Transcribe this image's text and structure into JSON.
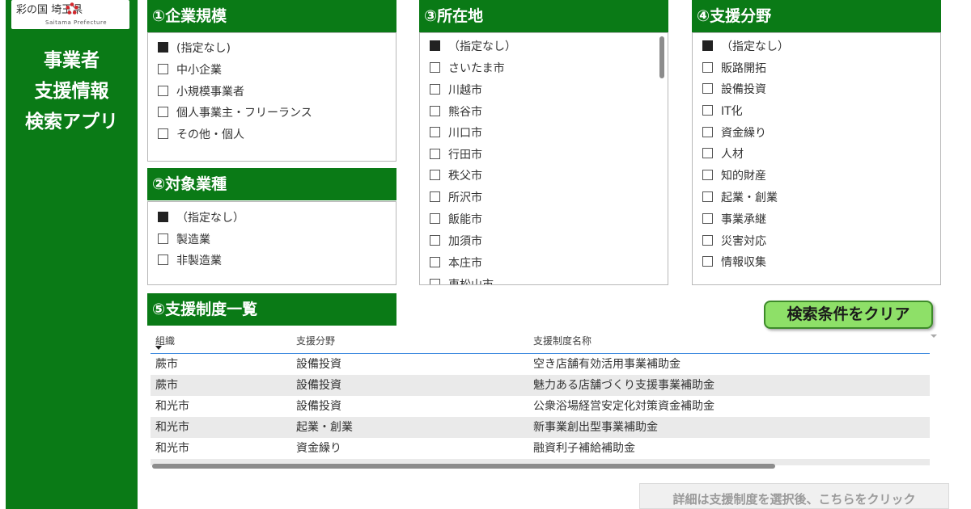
{
  "sidebar": {
    "logo_text": "彩の国 埼玉県",
    "logo_sub": "Saitama Prefecture",
    "app_title_lines": [
      "事業者",
      "支援情報",
      "検索アプリ"
    ],
    "brand_color": "#0a7a16"
  },
  "panels": {
    "company_size": {
      "title": "①企業規模",
      "options": [
        {
          "label": "(指定なし)",
          "checked": true
        },
        {
          "label": "中小企業",
          "checked": false
        },
        {
          "label": "小規模事業者",
          "checked": false
        },
        {
          "label": "個人事業主・フリーランス",
          "checked": false
        },
        {
          "label": "その他・個人",
          "checked": false
        }
      ]
    },
    "industry": {
      "title": "②対象業種",
      "options": [
        {
          "label": "（指定なし）",
          "checked": true
        },
        {
          "label": "製造業",
          "checked": false
        },
        {
          "label": "非製造業",
          "checked": false
        }
      ]
    },
    "location": {
      "title": "③所在地",
      "options": [
        {
          "label": "（指定なし）",
          "checked": true
        },
        {
          "label": "さいたま市",
          "checked": false
        },
        {
          "label": "川越市",
          "checked": false
        },
        {
          "label": "熊谷市",
          "checked": false
        },
        {
          "label": "川口市",
          "checked": false
        },
        {
          "label": "行田市",
          "checked": false
        },
        {
          "label": "秩父市",
          "checked": false
        },
        {
          "label": "所沢市",
          "checked": false
        },
        {
          "label": "飯能市",
          "checked": false
        },
        {
          "label": "加須市",
          "checked": false
        },
        {
          "label": "本庄市",
          "checked": false
        },
        {
          "label": "東松山市",
          "checked": false
        }
      ]
    },
    "support_field": {
      "title": "④支援分野",
      "options": [
        {
          "label": "（指定なし）",
          "checked": true
        },
        {
          "label": "販路開拓",
          "checked": false
        },
        {
          "label": "設備投資",
          "checked": false
        },
        {
          "label": "IT化",
          "checked": false
        },
        {
          "label": "資金繰り",
          "checked": false
        },
        {
          "label": "人材",
          "checked": false
        },
        {
          "label": "知的財産",
          "checked": false
        },
        {
          "label": "起業・創業",
          "checked": false
        },
        {
          "label": "事業承継",
          "checked": false
        },
        {
          "label": "災害対応",
          "checked": false
        },
        {
          "label": "情報収集",
          "checked": false
        }
      ]
    }
  },
  "list": {
    "title": "⑤支援制度一覧",
    "columns": [
      "組織",
      "支援分野",
      "支援制度名称"
    ],
    "rows": [
      [
        "蕨市",
        "設備投資",
        "空き店舗有効活用事業補助金"
      ],
      [
        "蕨市",
        "設備投資",
        "魅力ある店舗づくり支援事業補助金"
      ],
      [
        "和光市",
        "設備投資",
        "公衆浴場経営安定化対策資金補助金"
      ],
      [
        "和光市",
        "起業・創業",
        "新事業創出型事業補助金"
      ],
      [
        "和光市",
        "資金繰り",
        "融資利子補給補助金"
      ]
    ]
  },
  "buttons": {
    "clear": "検索条件をクリア",
    "detail": "詳細は支援制度を選択後、こちらをクリック"
  }
}
